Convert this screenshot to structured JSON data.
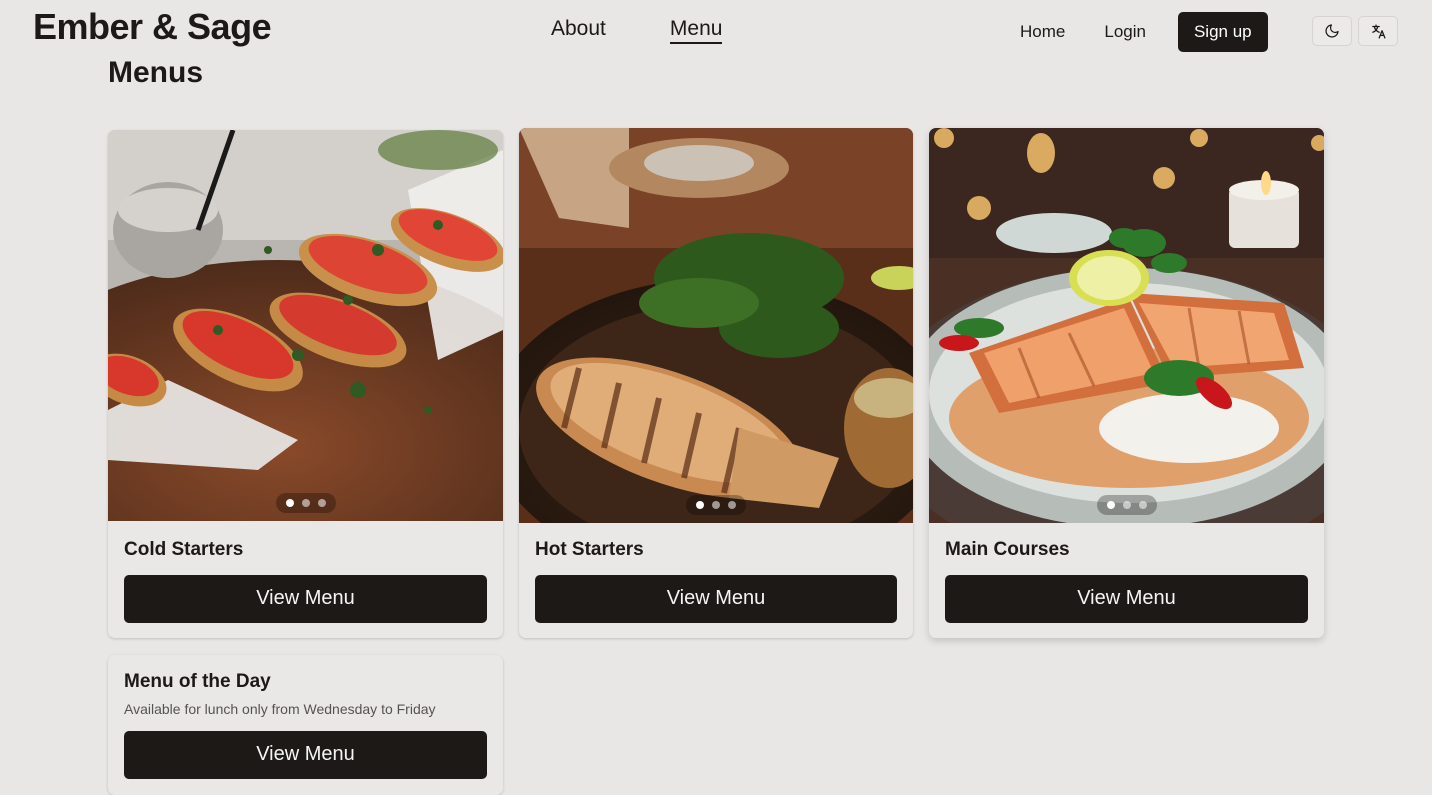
{
  "header": {
    "brand": "Ember & Sage",
    "nav": {
      "about": "About",
      "menu": "Menu"
    },
    "home": "Home",
    "login": "Login",
    "signup": "Sign up"
  },
  "page": {
    "title": "Menus"
  },
  "cards": [
    {
      "title": "Cold Starters",
      "button": "View Menu"
    },
    {
      "title": "Hot Starters",
      "button": "View Menu"
    },
    {
      "title": "Main Courses",
      "button": "View Menu"
    },
    {
      "title": "Menu of the Day",
      "description": "Available for lunch only from Wednesday to Friday",
      "button": "View Menu"
    }
  ],
  "icons": {
    "theme": "moon-icon",
    "language": "translate-icon"
  },
  "colors": {
    "background": "#e8e7e6",
    "primary": "#1c1917",
    "primary_text": "#f5f5f4"
  }
}
